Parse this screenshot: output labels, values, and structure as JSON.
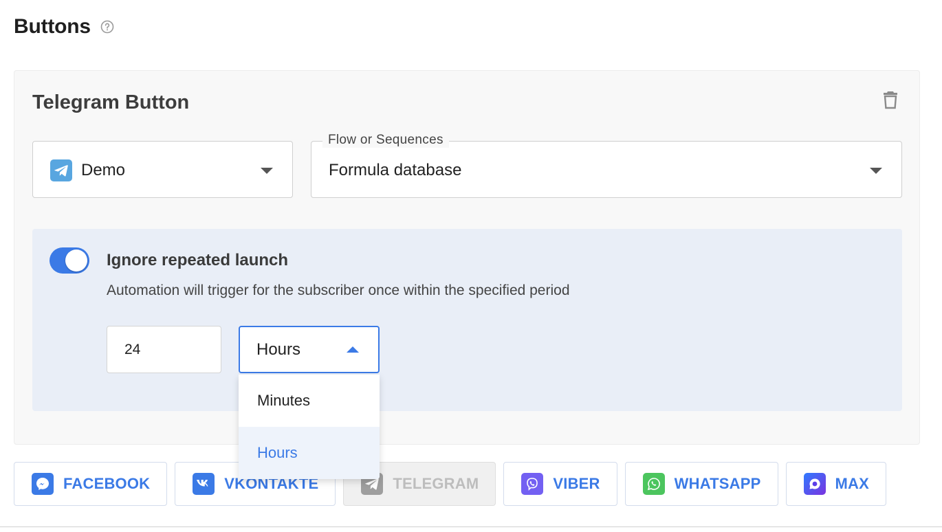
{
  "section": {
    "title": "Buttons"
  },
  "card": {
    "title": "Telegram Button",
    "bot_select": {
      "value": "Demo",
      "icon": "telegram-icon"
    },
    "flow_select": {
      "legend": "Flow or Sequences",
      "value": "Formula database"
    }
  },
  "repeat": {
    "enabled": true,
    "title": "Ignore repeated launch",
    "description": "Automation will trigger for the subscriber once within the specified period",
    "amount": "24",
    "unit": "Hours",
    "options": [
      "Minutes",
      "Hours"
    ],
    "selected_option": "Hours"
  },
  "channels": [
    {
      "label": "FACEBOOK",
      "icon": "messenger-icon",
      "color": "#3b7ae6",
      "disabled": false
    },
    {
      "label": "VKONTAKTE",
      "icon": "vk-icon",
      "color": "#3b7ae6",
      "disabled": false
    },
    {
      "label": "TELEGRAM",
      "icon": "telegram-icon",
      "color": "#9e9e9e",
      "disabled": true
    },
    {
      "label": "VIBER",
      "icon": "viber-icon",
      "color": "#7360f2",
      "disabled": false
    },
    {
      "label": "WHATSAPP",
      "icon": "whatsapp-icon",
      "color": "#4cc55e",
      "disabled": false
    },
    {
      "label": "MAX",
      "icon": "max-icon",
      "color": "#5b3ee8",
      "disabled": false
    }
  ],
  "colors": {
    "accent": "#3b7ae6",
    "panel": "#e9eef7",
    "card": "#f8f8f8"
  }
}
